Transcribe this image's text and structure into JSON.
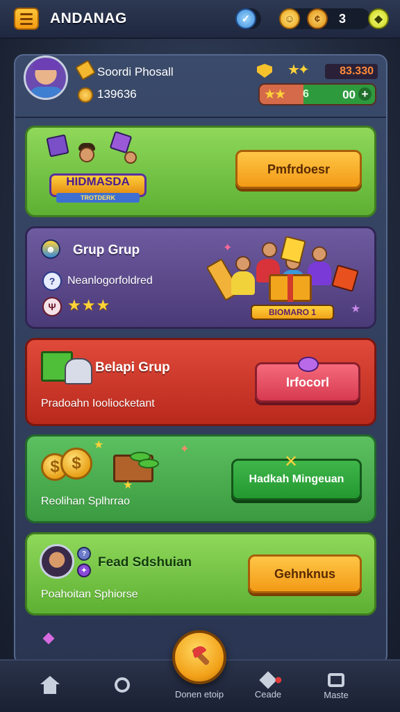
{
  "header": {
    "title": "ANDANAG",
    "resource_value": "3",
    "icons": [
      "menu-icon",
      "badge-icon",
      "smile-coin-icon",
      "gold-coin-icon",
      "gem-icon"
    ]
  },
  "profile": {
    "name": "Soordi Phosall",
    "coins": "139636",
    "score": "83.330",
    "progress_level": "6",
    "progress_value": "00",
    "progress_stars": "★★",
    "progress_fraction": 0.38
  },
  "cards": {
    "event": {
      "banner": "HIDMASDA",
      "ribbon": "TROTDERK",
      "button": "Pmfrdoesr"
    },
    "group": {
      "title": "Grup Grup",
      "subtitle": "Neanlogorfoldred",
      "stars": "★★★",
      "banner": "BIOMARO 1"
    },
    "red": {
      "title": "Belapi Grup",
      "subtitle": "Pradoahn Iooliocketant",
      "button": "Irfocorl"
    },
    "green2": {
      "subtitle": "Reolihan Splhrrao",
      "button": "Hadkah Mingeuan"
    },
    "green3": {
      "title": "Fead Sdshuian",
      "subtitle": "Poahoitan Sphiorse",
      "button": "Gehnknus"
    }
  },
  "nav": {
    "items": [
      {
        "label": ""
      },
      {
        "label": ""
      },
      {
        "label": "Donen etoip"
      },
      {
        "label": "Ceade"
      },
      {
        "label": "Maste"
      }
    ]
  },
  "colors": {
    "orange_button": "#f29a16",
    "pink_button": "#d73a50",
    "green_button": "#239830",
    "panel_bg": "#2a3552"
  }
}
